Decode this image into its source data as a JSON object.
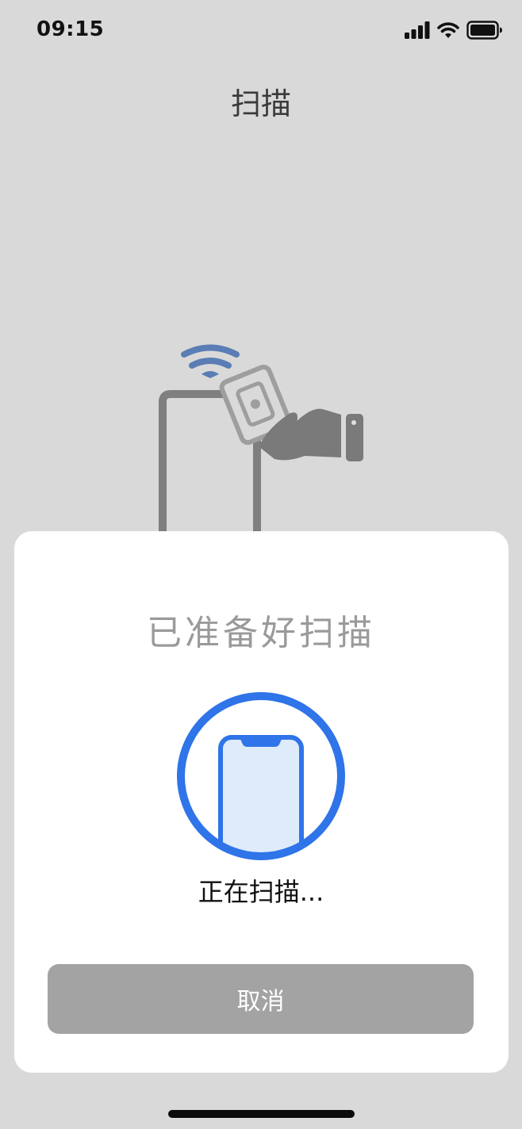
{
  "status_bar": {
    "time": "09:15",
    "icons": [
      "cellular-signal-icon",
      "wifi-icon",
      "battery-icon"
    ]
  },
  "page": {
    "title": "扫描"
  },
  "illustration": {
    "icon": "nfc-phone-tap-icon"
  },
  "scan_sheet": {
    "title": "已准备好扫描",
    "status_text": "正在扫描...",
    "graphic_icon": "phone-scan-icon",
    "cancel_label": "取消"
  },
  "colors": {
    "background": "#d9d9d9",
    "sheet": "#ffffff",
    "accent_blue": "#2f74e8",
    "nfc_wave_blue": "#5a7db5",
    "button_gray": "#a3a3a3"
  }
}
